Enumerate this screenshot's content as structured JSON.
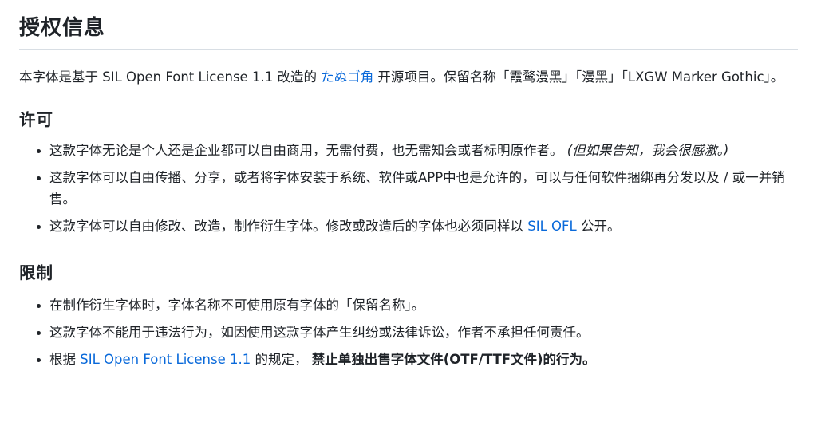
{
  "heading": "授权信息",
  "intro": {
    "part1": "本字体是基于 SIL Open Font License 1.1 改造的 ",
    "link": "たぬゴ角",
    "part2": " 开源项目。保留名称「霞鹜漫黑」「漫黑」「LXGW Marker Gothic」。"
  },
  "license": {
    "title": "许可",
    "item1": {
      "text": "这款字体无论是个人还是企业都可以自由商用，无需付费，也无需知会或者标明原作者。 ",
      "note": "(但如果告知，我会很感激。)"
    },
    "item2": {
      "text": "这款字体可以自由传播、分享，或者将字体安装于系统、软件或APP中也是允许的，可以与任何软件捆绑再分发以及 / 或一并销售。"
    },
    "item3": {
      "text": "这款字体可以自由修改、改造，制作衍生字体。修改或改造后的字体也必须同样以 ",
      "link": "SIL OFL",
      "tail": " 公开。"
    }
  },
  "restrictions": {
    "title": "限制",
    "item1": {
      "text": "在制作衍生字体时，字体名称不可使用原有字体的「保留名称」。"
    },
    "item2": {
      "text": "这款字体不能用于违法行为，如因使用这款字体产生纠纷或法律诉讼，作者不承担任何责任。"
    },
    "item3": {
      "text": "根据 ",
      "link": "SIL Open Font License 1.1",
      "mid": " 的规定， ",
      "strong": "禁止单独出售字体文件(OTF/TTF文件)的行为。"
    }
  },
  "colors": {
    "link": "#0969da",
    "text": "#1f2328",
    "divider": "#d8dee4"
  }
}
